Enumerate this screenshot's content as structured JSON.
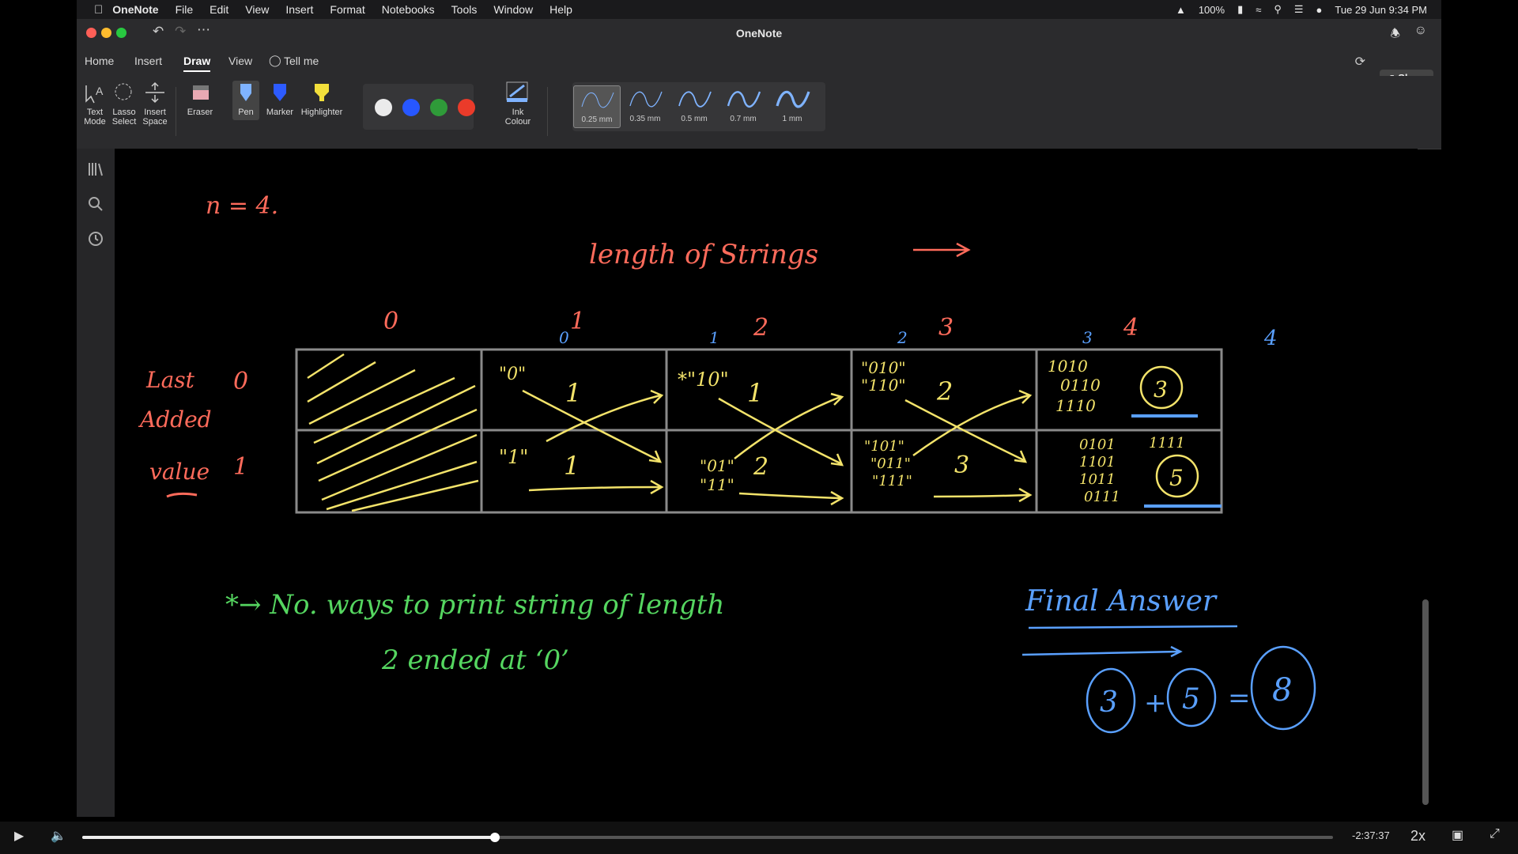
{
  "menubar": {
    "app": "OneNote",
    "items": [
      "File",
      "Edit",
      "View",
      "Insert",
      "Format",
      "Notebooks",
      "Tools",
      "Window",
      "Help"
    ],
    "battery": "100%",
    "datetime": "Tue 29 Jun  9:34 PM"
  },
  "window": {
    "title": "OneNote"
  },
  "tabs": [
    "Home",
    "Insert",
    "Draw",
    "View",
    "Tell me"
  ],
  "active_tab": "Draw",
  "share_label": "Share",
  "ribbon": {
    "text_mode": [
      "Text",
      "Mode"
    ],
    "lasso": [
      "Lasso",
      "Select"
    ],
    "insert_space": [
      "Insert",
      "Space"
    ],
    "eraser": "Eraser",
    "pen": "Pen",
    "marker": "Marker",
    "highlighter": "Highlighter",
    "ink_colour": [
      "Ink",
      "Colour"
    ],
    "pen_sizes": [
      "0.25 mm",
      "0.35 mm",
      "0.5 mm",
      "0.7 mm",
      "1 mm"
    ],
    "selected_pen_size": "0.25 mm",
    "colors": [
      "#ebebeb",
      "#2757ff",
      "#2f9b39",
      "#ea3b2a"
    ]
  },
  "notes": {
    "n_eq": "n = 4.",
    "length_of_strings": "length of Strings",
    "col_headers": [
      "0",
      "1",
      "2",
      "3",
      "4"
    ],
    "row_label": [
      "Last",
      "Added",
      "value"
    ],
    "row_values": [
      "0",
      "1"
    ],
    "cells": {
      "r0": [
        {
          "strings": [
            "\"0\""
          ],
          "count": "1"
        },
        {
          "strings": [
            "*\"10\""
          ],
          "count": "1"
        },
        {
          "strings": [
            "\"010\"",
            "\"110\""
          ],
          "count": "2"
        },
        {
          "strings": [
            "1010",
            "0110",
            "1110"
          ],
          "count": "3"
        }
      ],
      "r1": [
        {
          "strings": [
            "\"1\""
          ],
          "count": "1"
        },
        {
          "strings": [
            "\"01\"",
            "\"11\""
          ],
          "count": "2"
        },
        {
          "strings": [
            "\"101\"",
            "\"011\"",
            "\"111\""
          ],
          "count": "3"
        },
        {
          "strings": [
            "0101",
            "1101",
            "1011",
            "0111",
            "1111"
          ],
          "count": "5"
        }
      ]
    },
    "bullet": "*→ No. ways to print string of length",
    "bullet_line2": "2  ended at ‘0’",
    "final_answer": "Final Answer",
    "eq": [
      "3",
      "5",
      "8"
    ]
  },
  "player": {
    "time": "-2:37:37",
    "speed": "2x",
    "progress_pct": 33
  }
}
